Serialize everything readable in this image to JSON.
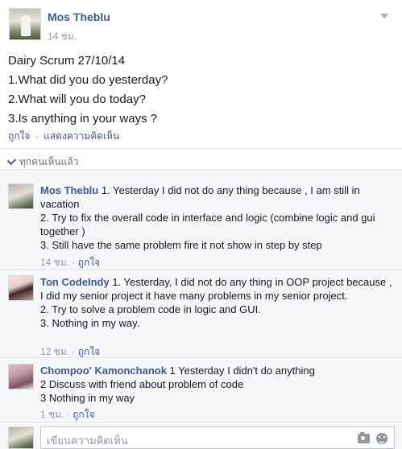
{
  "post": {
    "author": "Mos Theblu",
    "time": "14 ชม.",
    "lines": [
      "Dairy Scrum 27/10/14",
      "1.What did you do yesterday?",
      "2.What will you do today?",
      "3.Is anything in your ways ?"
    ],
    "actions": {
      "like": "ถูกใจ",
      "separator": "·",
      "comment": "แสดงความคิดเห็น"
    },
    "seen_by": "ทุกคนเห็นแล้ว"
  },
  "comments": [
    {
      "author": "Mos Theblu",
      "text_lines": [
        " 1. Yesterday I did not do any thing because , I am still in vacation",
        "2. Try to fix the overall code in interface and logic (combine logic and gui together )",
        "3. Still have the same problem fire it not show in step by step"
      ],
      "time": "14 ชม.",
      "separator": "·",
      "like": "ถูกใจ"
    },
    {
      "author": "Ton CodeIndy",
      "text_lines": [
        " 1. Yesterday, I did not do any thing in OOP project because , I did my senior project it have many problems in my senior project.",
        "2. Try to solve a problem code in logic and GUI.",
        "3. Nothing in my way."
      ],
      "time": "12 ชม.",
      "separator": "·",
      "like": "ถูกใจ"
    },
    {
      "author": "Chompoo' Kamonchanok",
      "text_lines": [
        " 1 Yesterday I didn't do anything",
        "2 Discuss with friend about problem of code",
        "3 Nothing in my way"
      ],
      "time": "1 ชม.",
      "separator": "·",
      "like": "ถูกใจ"
    }
  ],
  "composer": {
    "placeholder": "เขียนความคิดเห็น",
    "icons": [
      "camera-icon",
      "emoji-icon"
    ]
  },
  "colors": {
    "link": "#3b5998",
    "meta": "#9197a3",
    "comments_bg": "#f6f7f9"
  }
}
